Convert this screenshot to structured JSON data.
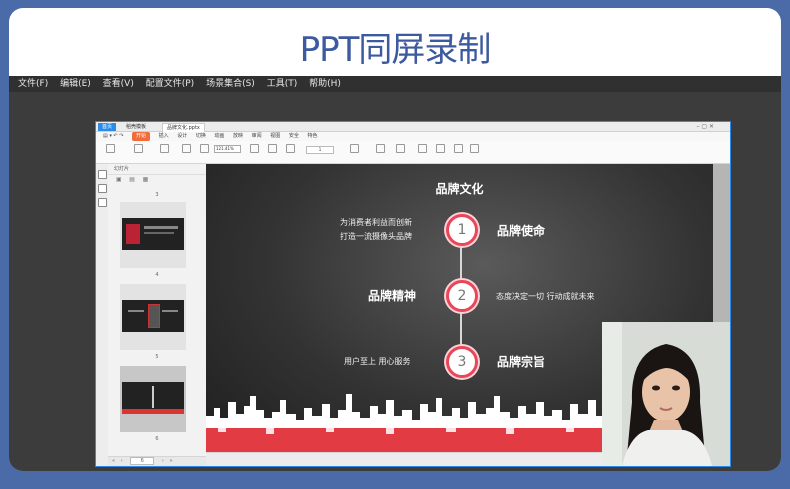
{
  "headline": "PPT同屏录制",
  "menu": [
    "文件(F)",
    "编辑(E)",
    "查看(V)",
    "配置文件(P)",
    "场景集合(S)",
    "工具(T)",
    "帮助(H)"
  ],
  "wps": {
    "tab_home": "首页",
    "tab_docer": "稻壳模板",
    "tab_doc": "品牌文化.pptx",
    "ribbon_start": "开始",
    "ribbon_menu": [
      "插入",
      "设计",
      "切换",
      "动画",
      "放映",
      "审阅",
      "视图",
      "安全",
      "特色"
    ],
    "zoom": "121.41%",
    "thumb_panel_title": "幻灯片",
    "thumb_numbers": [
      "3",
      "4",
      "5",
      "6"
    ],
    "page_input": "6"
  },
  "slide": {
    "title": "品牌文化",
    "nodes": [
      "1",
      "2",
      "3"
    ],
    "item1_title": "品牌使命",
    "item1_desc_l1": "为消费者利益而创新",
    "item1_desc_l2": "打造一流摄像头品牌",
    "item2_title": "品牌精神",
    "item2_desc": "态度决定一切 行动成就未来",
    "item3_title": "品牌宗旨",
    "item3_desc": "用户至上 用心服务"
  },
  "colors": {
    "accent_red": "#e8475a",
    "brand_blue": "#3d5aa0",
    "capture_border": "#2d8ae6"
  }
}
